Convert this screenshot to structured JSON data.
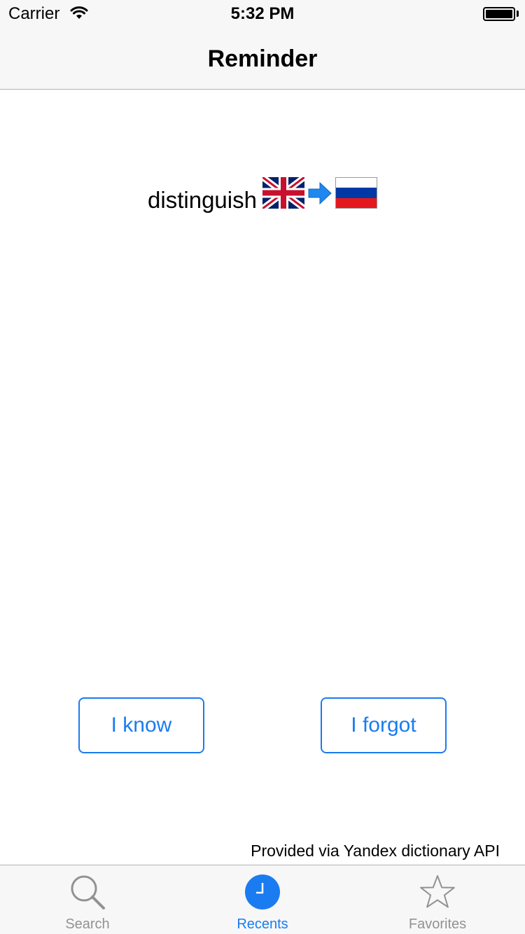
{
  "status_bar": {
    "carrier": "Carrier",
    "time": "5:32 PM",
    "icons": [
      "wifi-icon",
      "battery-icon"
    ]
  },
  "nav": {
    "title": "Reminder"
  },
  "card": {
    "word": "distinguish",
    "source_flag": "uk-flag-icon",
    "direction_icon": "arrow-right-icon",
    "target_flag": "russia-flag-icon"
  },
  "actions": {
    "know_label": "I know",
    "forgot_label": "I forgot"
  },
  "footer": {
    "credit": "Provided via Yandex dictionary API"
  },
  "tab_bar": {
    "tabs": [
      {
        "label": "Search",
        "icon": "search-icon",
        "active": false
      },
      {
        "label": "Recents",
        "icon": "clock-icon",
        "active": true
      },
      {
        "label": "Favorites",
        "icon": "star-icon",
        "active": false
      }
    ]
  },
  "colors": {
    "accent": "#1a7cf0",
    "inactive_tab": "#929292",
    "bar_background": "#f7f7f7"
  }
}
